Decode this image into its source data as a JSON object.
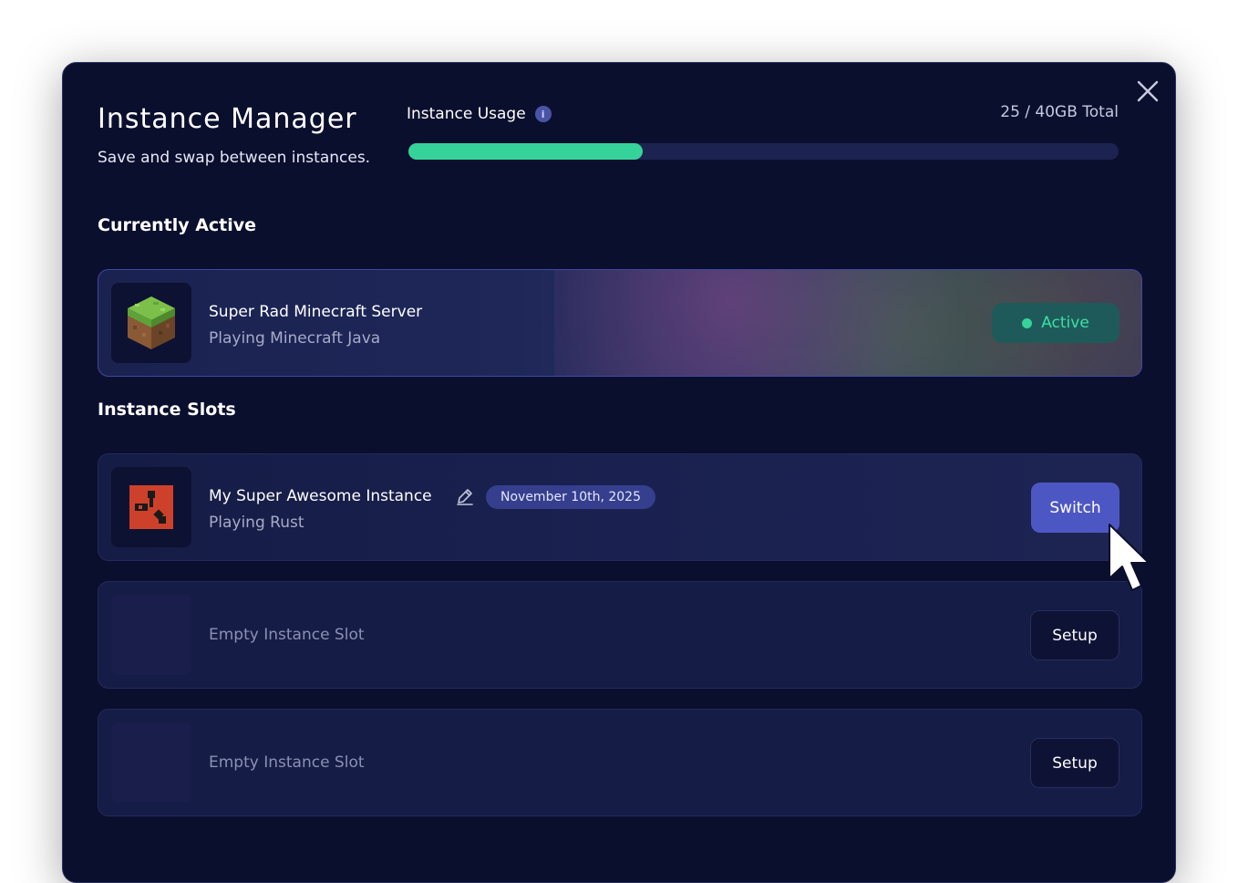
{
  "header": {
    "title": "Instance Manager",
    "subtitle": "Save and swap between instances."
  },
  "usage": {
    "label": "Instance Usage",
    "total_text": "25 / 40GB Total",
    "fill_fraction": 0.33,
    "fill_color": "#35d39a"
  },
  "sections": {
    "active_heading": "Currently Active",
    "slots_heading": "Instance Slots"
  },
  "active_instance": {
    "name": "Super Rad Minecraft Server",
    "subtitle": "Playing Minecraft Java",
    "status": "Active",
    "icon": "minecraft-grass-block-icon"
  },
  "slots": [
    {
      "name": "My Super Awesome Instance",
      "subtitle": "Playing Rust",
      "date": "November 10th, 2025",
      "action": "Switch",
      "icon": "rust-logo-icon"
    },
    {
      "label": "Empty Instance Slot",
      "action": "Setup"
    },
    {
      "label": "Empty Instance Slot",
      "action": "Setup"
    }
  ],
  "colors": {
    "background": "#0b0f2e",
    "accent": "#4d57c3",
    "success": "#35d39a"
  }
}
